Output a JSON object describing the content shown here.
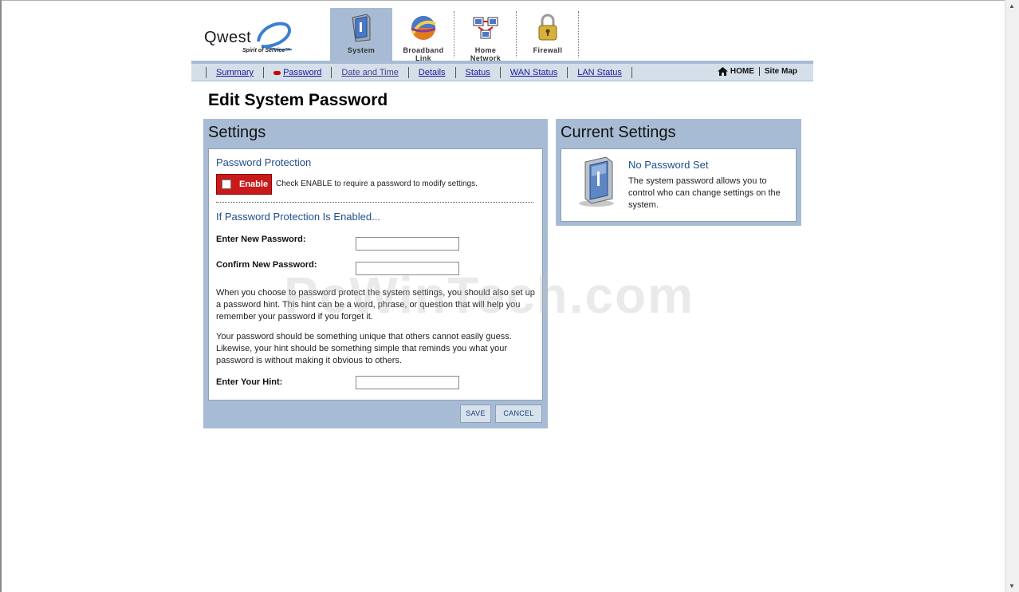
{
  "brand": {
    "logo_word": "Qwest",
    "tagline": "Spirit of Service™"
  },
  "tabs": [
    {
      "label": "System",
      "icon": "system-icon",
      "active": true
    },
    {
      "label": "Broadband\nLink",
      "icon": "broadband-link-icon",
      "active": false
    },
    {
      "label": "Home\nNetwork",
      "icon": "home-network-icon",
      "active": false
    },
    {
      "label": "Firewall",
      "icon": "firewall-lock-icon",
      "active": false
    }
  ],
  "nav": {
    "items": [
      "Summary",
      "Password",
      "Date and Time",
      "Details",
      "Status",
      "WAN Status",
      "LAN Status"
    ],
    "home": "HOME",
    "site_map": "Site Map"
  },
  "page_title": "Edit System Password",
  "settings": {
    "title": "Settings",
    "protection_heading": "Password Protection",
    "enable_label": "Enable",
    "enable_checked": false,
    "enable_desc": "Check ENABLE to require a password to modify settings.",
    "enabled_heading": "If Password Protection Is Enabled...",
    "new_password_label": "Enter New Password:",
    "new_password_value": "",
    "confirm_password_label": "Confirm New Password:",
    "confirm_password_value": "",
    "hint_paragraph": "When you choose to password protect the system settings, you should also set up a password hint. This hint can be a word, phrase, or question that will help you remember your password if you forget it.",
    "unique_paragraph": "Your password should be something unique that others cannot easily guess. Likewise, your hint should be something simple that reminds you what your password is without making it obvious to others.",
    "hint_label": "Enter Your Hint:",
    "hint_value": "",
    "save_label": "SAVE",
    "cancel_label": "CANCEL"
  },
  "current": {
    "title": "Current Settings",
    "status": "No Password Set",
    "description": "The system password allows you to control who can change settings on the system."
  },
  "watermark": "PcWinTech.com",
  "colors": {
    "panel_blue": "#a7bcd4",
    "nav_bg": "#d4dfea",
    "heading_blue": "#1f4f8a",
    "enable_red": "#c81a1a"
  }
}
